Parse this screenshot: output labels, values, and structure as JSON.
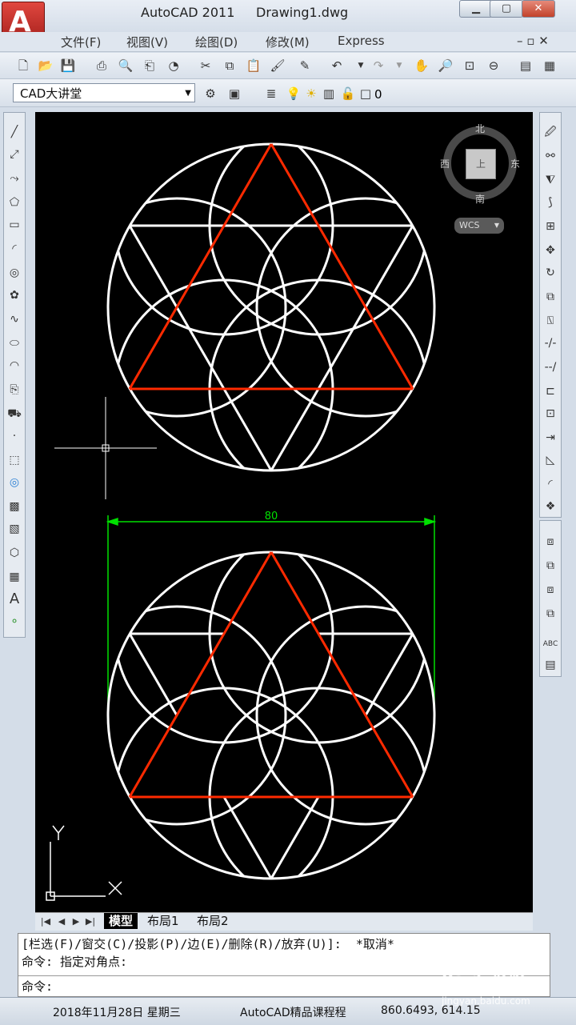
{
  "window": {
    "app_name": "AutoCAD 2011",
    "file_name": "Drawing1.dwg",
    "min": "▁",
    "max": "▢",
    "close": "✕"
  },
  "menu": [
    "文件(F)",
    "视图(V)",
    "绘图(D)",
    "修改(M)",
    "Express"
  ],
  "workspace": {
    "selected": "CAD大讲堂"
  },
  "layer": {
    "current": "0"
  },
  "viewcube": {
    "north": "北",
    "south": "南",
    "east": "东",
    "west": "西",
    "top": "上",
    "wcs": "WCS"
  },
  "drawing": {
    "dimension_value": "80",
    "ucs_x": "X",
    "ucs_y": "Y"
  },
  "tabs": [
    "模型",
    "布局1",
    "布局2"
  ],
  "command": {
    "line1": "[栏选(F)/窗交(C)/投影(P)/边(E)/删除(R)/放弃(U)]:  *取消*",
    "line2": "命令: 指定对角点:",
    "prompt": "命令:"
  },
  "status": {
    "date": "2018年11月28日 星期三",
    "course": "AutoCAD精品课程程",
    "coords": "860.6493, 614.15"
  },
  "watermark": {
    "brand": "Baidu经验",
    "url": "jingyan.baidu.com"
  },
  "colors": {
    "canvas": "#000000",
    "geometry": "#ffffff",
    "triangle": "#ff2a00",
    "dimension": "#00e000"
  }
}
